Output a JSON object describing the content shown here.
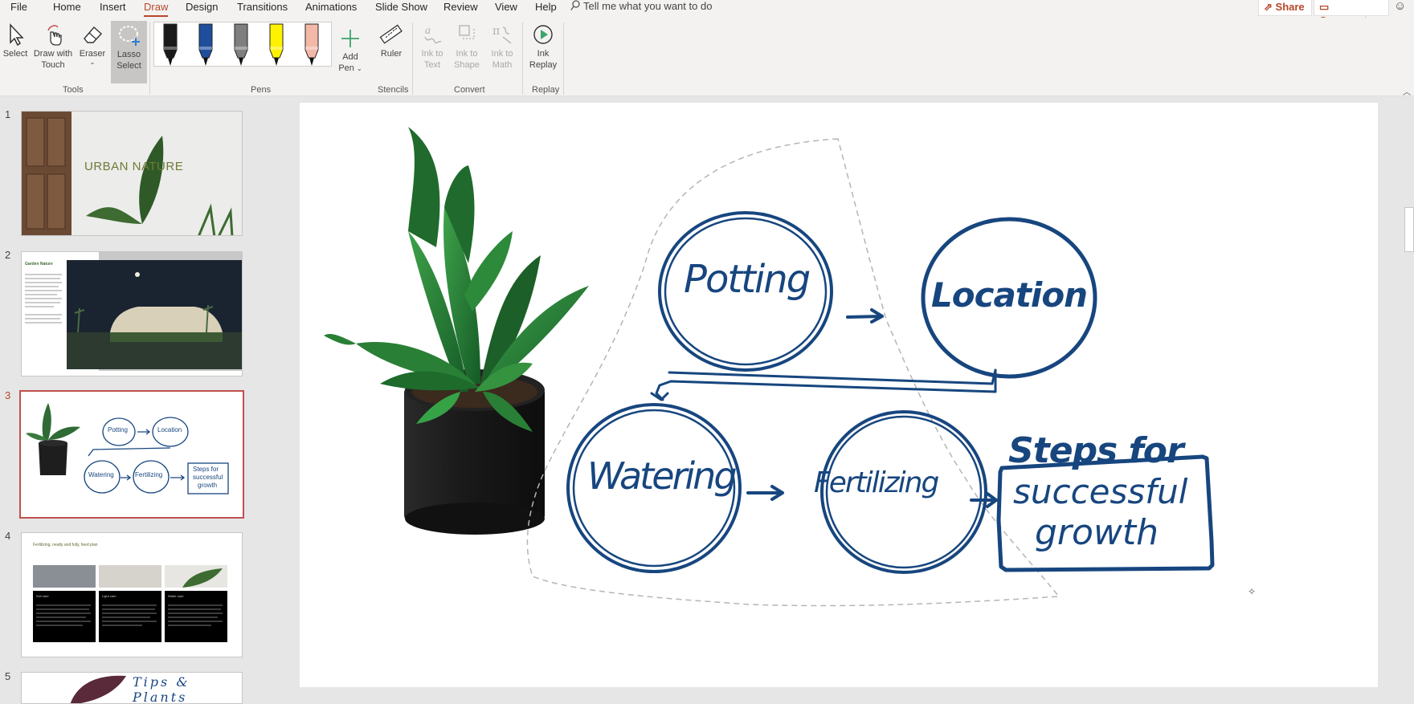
{
  "menu": {
    "tabs": [
      "File",
      "Home",
      "Insert",
      "Draw",
      "Design",
      "Transitions",
      "Animations",
      "Slide Show",
      "Review",
      "View",
      "Help"
    ],
    "active_tab": "Draw",
    "tell_me": "Tell me what you want to do",
    "share": "Share",
    "comments": "Comments"
  },
  "ribbon": {
    "tools": {
      "select": "Select",
      "draw_with_touch": [
        "Draw with",
        "Touch"
      ],
      "eraser": "Eraser",
      "lasso_select": [
        "Lasso",
        "Select"
      ],
      "group_label": "Tools"
    },
    "pens": {
      "colors": [
        "#1a1a1a",
        "#1f4e9c",
        "#7f7f7f",
        "#fff200",
        "#f4b8a8"
      ],
      "group_label": "Pens"
    },
    "add_pen": [
      "Add",
      "Pen"
    ],
    "ruler": "Ruler",
    "stencils_label": "Stencils",
    "convert": {
      "ink_to_text": [
        "Ink to",
        "Text"
      ],
      "ink_to_shape": [
        "Ink to",
        "Shape"
      ],
      "ink_to_math": [
        "Ink to",
        "Math"
      ],
      "group_label": "Convert"
    },
    "replay": {
      "ink_replay": [
        "Ink",
        "Replay"
      ],
      "group_label": "Replay"
    }
  },
  "slides": {
    "numbers": [
      "1",
      "2",
      "3",
      "4",
      "5"
    ],
    "active": "3",
    "slide1_title": "URBAN NATURE",
    "slide2_title": "Garden Nature",
    "slide3_words": [
      "Potting",
      "Location",
      "Watering",
      "Fertilizing",
      "Steps for",
      "successful",
      "growth"
    ],
    "slide4_title": "Fertilizing, neatly and fully, feed plan",
    "slide4_cols": [
      "Soil care",
      "Light care",
      "Water care"
    ],
    "slide5_text": "Tips & Plants"
  },
  "canvas": {
    "words": {
      "potting": "Potting",
      "location": "Location",
      "watering": "Watering",
      "fertilizing": "Fertilizing",
      "steps": [
        "Steps for",
        "successful",
        "growth"
      ]
    },
    "ink_color": "#17467f",
    "lasso_color": "#b5b5b5"
  }
}
